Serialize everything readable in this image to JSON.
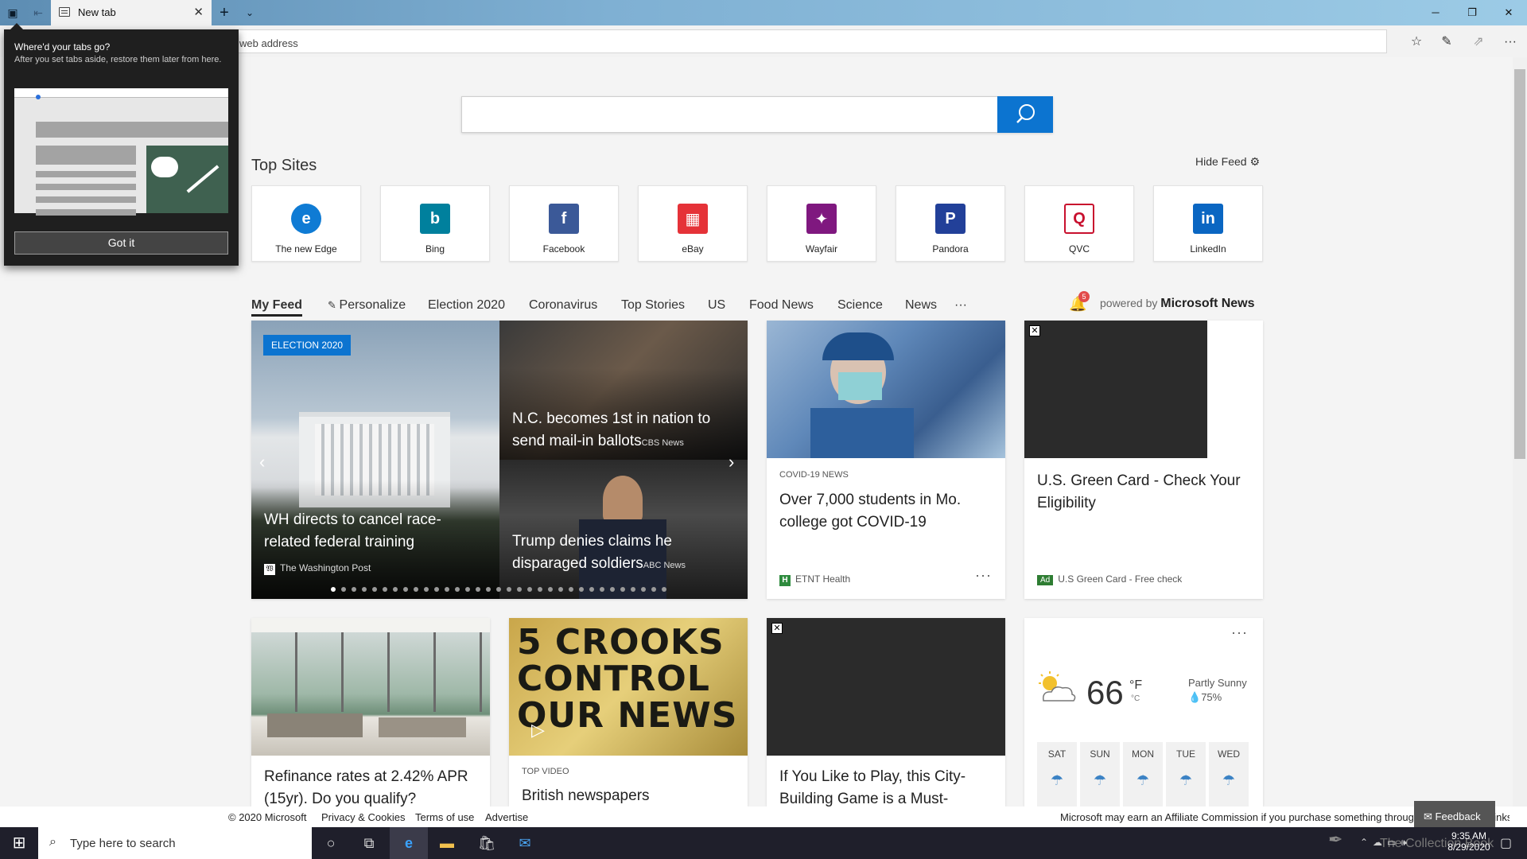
{
  "browser": {
    "tab_title": "New tab",
    "address_placeholder": "Search or enter web address",
    "address_visible": "web address"
  },
  "popup": {
    "title": "Where'd your tabs go?",
    "description": "After you set tabs aside, restore them later from here.",
    "button": "Got it"
  },
  "top_sites": {
    "heading": "Top Sites",
    "hide_feed": "Hide Feed",
    "sites": [
      {
        "name": "The new Edge",
        "icon": "edge-icon",
        "color": "#0f7bd4"
      },
      {
        "name": "Bing",
        "icon": "bing-icon",
        "color": "#00809d"
      },
      {
        "name": "Facebook",
        "icon": "facebook-icon",
        "color": "#3b5998"
      },
      {
        "name": "eBay",
        "icon": "ebay-icon",
        "color": "#e53238"
      },
      {
        "name": "Wayfair",
        "icon": "wayfair-icon",
        "color": "#7f187f"
      },
      {
        "name": "Pandora",
        "icon": "pandora-icon",
        "color": "#224099"
      },
      {
        "name": "QVC",
        "icon": "qvc-icon",
        "color": "#c8102e"
      },
      {
        "name": "LinkedIn",
        "icon": "linkedin-icon",
        "color": "#0a66c2"
      }
    ]
  },
  "feed_nav": {
    "items": [
      "My Feed",
      "Personalize",
      "Election 2020",
      "Coronavirus",
      "Top Stories",
      "US",
      "Food News",
      "Science",
      "News",
      "···"
    ],
    "notifications": "5",
    "powered_prefix": "powered by",
    "powered_brand": "Microsoft News"
  },
  "cards": {
    "hero": {
      "badge": "ELECTION 2020",
      "left_title": "WH directs to cancel race-related federal training",
      "left_source": "The Washington Post",
      "right_top_title": "N.C. becomes 1st in nation to send mail-in ballots",
      "right_top_source": "CBS News",
      "right_bottom_title": "Trump denies claims he disparaged soldiers",
      "right_bottom_source": "ABC News"
    },
    "covid": {
      "category": "COVID-19 NEWS",
      "title": "Over 7,000 students in Mo. college got COVID-19",
      "source": "ETNT Health",
      "source_mark": "H",
      "more": "···"
    },
    "ad1": {
      "title": "U.S. Green Card - Check Your Eligibility",
      "ad_label": "Ad",
      "source": "U.S Green Card - Free check"
    },
    "refinance": {
      "title": "Refinance rates at 2.42% APR (15yr). Do you qualify?"
    },
    "video": {
      "image_text": "5 CROOKS CONTROL OUR NEWS",
      "category": "TOP VIDEO",
      "title": "British newspapers"
    },
    "game": {
      "title": "If You Like to Play, this City-Building Game is a Must-"
    },
    "weather": {
      "temp": "66",
      "unit_f": "°F",
      "unit_c": "°C",
      "condition": "Partly Sunny",
      "precip": "75%",
      "more": "···",
      "days": [
        "SAT",
        "SUN",
        "MON",
        "TUE",
        "WED"
      ]
    }
  },
  "footer": {
    "copyright": "© 2020 Microsoft",
    "privacy": "Privacy & Cookies",
    "terms": "Terms of use",
    "advertise": "Advertise",
    "affiliate": "Microsoft may earn an Affiliate Commission if you purchase something through recommended links in this page.",
    "feedback": "Feedback"
  },
  "taskbar": {
    "search_placeholder": "Type here to search",
    "time": "9:35 AM",
    "date": "8/29/2020",
    "watermark": "The Collection Book"
  }
}
